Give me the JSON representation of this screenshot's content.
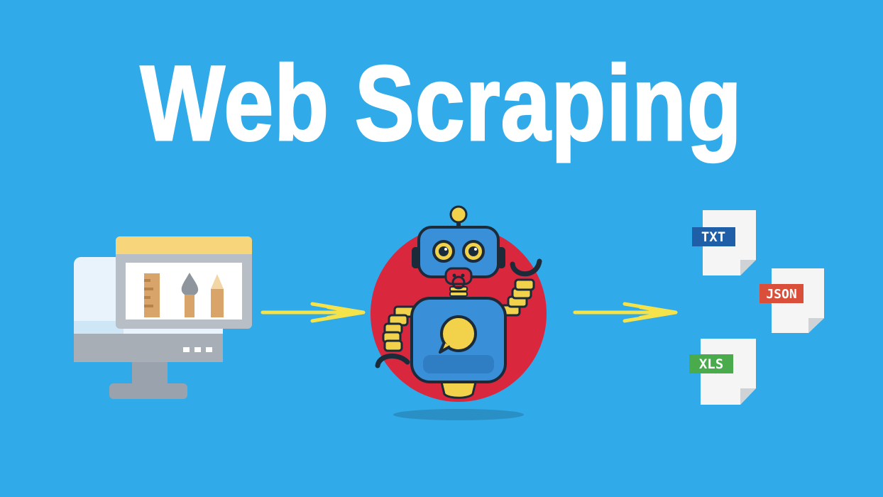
{
  "title": "Web Scraping",
  "colors": {
    "background": "#30aae8",
    "robot_body": "#3a8fd9",
    "robot_circle": "#d9273d",
    "arrow": "#f4e34a",
    "label_txt": "#1f5fa8",
    "label_json": "#d94f3a",
    "label_xls": "#4aab4d"
  },
  "files": [
    {
      "label": "TXT"
    },
    {
      "label": "JSON"
    },
    {
      "label": "XLS"
    }
  ]
}
